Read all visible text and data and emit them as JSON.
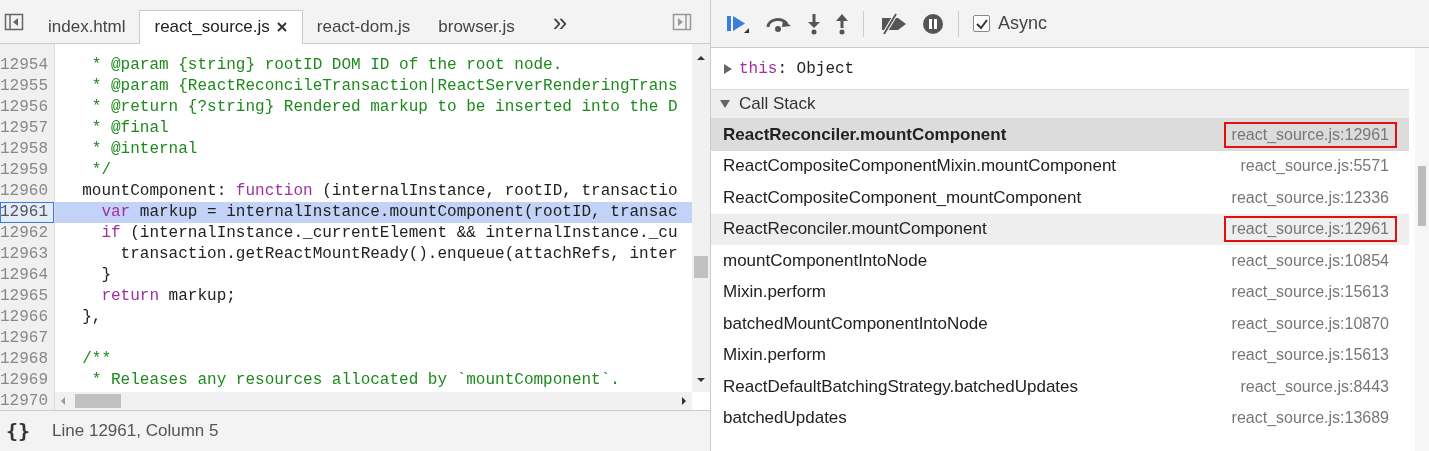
{
  "editor": {
    "tabs": [
      {
        "label": "index.html",
        "selected": false,
        "closable": false
      },
      {
        "label": "react_source.js",
        "selected": true,
        "closable": true
      },
      {
        "label": "react-dom.js",
        "selected": false,
        "closable": false
      },
      {
        "label": "browser.js",
        "selected": false,
        "closable": false
      }
    ],
    "more_tabs": "»",
    "lines": [
      {
        "number": "12954",
        "selected": false,
        "segments": [
          {
            "kind": "comment",
            "text": "   * @param {string} rootID DOM ID of the root node."
          }
        ]
      },
      {
        "number": "12955",
        "selected": false,
        "segments": [
          {
            "kind": "comment",
            "text": "   * @param {ReactReconcileTransaction|ReactServerRenderingTrans"
          }
        ]
      },
      {
        "number": "12956",
        "selected": false,
        "segments": [
          {
            "kind": "comment",
            "text": "   * @return {?string} Rendered markup to be inserted into the D"
          }
        ]
      },
      {
        "number": "12957",
        "selected": false,
        "segments": [
          {
            "kind": "comment",
            "text": "   * @final"
          }
        ]
      },
      {
        "number": "12958",
        "selected": false,
        "segments": [
          {
            "kind": "comment",
            "text": "   * @internal"
          }
        ]
      },
      {
        "number": "12959",
        "selected": false,
        "segments": [
          {
            "kind": "comment",
            "text": "   */"
          }
        ]
      },
      {
        "number": "12960",
        "selected": false,
        "segments": [
          {
            "kind": "plain",
            "text": "  mountComponent: "
          },
          {
            "kind": "keyword",
            "text": "function"
          },
          {
            "kind": "plain",
            "text": " (internalInstance, rootID, transactio"
          }
        ]
      },
      {
        "number": "12961",
        "selected": true,
        "segments": [
          {
            "kind": "keyword",
            "text": "    var"
          },
          {
            "kind": "plain",
            "text": " markup = internalInstance.mountComponent(rootID, transac"
          }
        ]
      },
      {
        "number": "12962",
        "selected": false,
        "segments": [
          {
            "kind": "keyword",
            "text": "    if"
          },
          {
            "kind": "plain",
            "text": " (internalInstance._currentElement && internalInstance._cu"
          }
        ]
      },
      {
        "number": "12963",
        "selected": false,
        "segments": [
          {
            "kind": "plain",
            "text": "      transaction.getReactMountReady().enqueue(attachRefs, inter"
          }
        ]
      },
      {
        "number": "12964",
        "selected": false,
        "segments": [
          {
            "kind": "plain",
            "text": "    }"
          }
        ]
      },
      {
        "number": "12965",
        "selected": false,
        "segments": [
          {
            "kind": "keyword",
            "text": "    return"
          },
          {
            "kind": "plain",
            "text": " markup;"
          }
        ]
      },
      {
        "number": "12966",
        "selected": false,
        "segments": [
          {
            "kind": "plain",
            "text": "  },"
          }
        ]
      },
      {
        "number": "12967",
        "selected": false
      },
      {
        "number": "12968",
        "selected": false,
        "segments": [
          {
            "kind": "comment",
            "text": "  /**"
          }
        ]
      },
      {
        "number": "12969",
        "selected": false,
        "segments": [
          {
            "kind": "comment",
            "text": "   * Releases any resources allocated by `mountComponent`."
          }
        ]
      },
      {
        "number": "12970",
        "selected": false
      }
    ],
    "status_bar": {
      "format_icon": "{}",
      "position": "Line 12961, Column 5"
    }
  },
  "debugger": {
    "async": {
      "label": "Async",
      "checked": true
    },
    "scope": {
      "name": "this",
      "value": ": Object"
    },
    "call_stack": {
      "title": "Call Stack",
      "expanded": true,
      "frames": [
        {
          "name": "ReactReconciler.mountComponent",
          "location": "react_source.js:12961",
          "selected": true,
          "hovered": false,
          "outlined": true
        },
        {
          "name": "ReactCompositeComponentMixin.mountComponent",
          "location": "react_source.js:5571",
          "selected": false,
          "hovered": false,
          "outlined": false
        },
        {
          "name": "ReactCompositeComponent_mountComponent",
          "location": "react_source.js:12336",
          "selected": false,
          "hovered": false,
          "outlined": false
        },
        {
          "name": "ReactReconciler.mountComponent",
          "location": "react_source.js:12961",
          "selected": false,
          "hovered": true,
          "outlined": true
        },
        {
          "name": "mountComponentIntoNode",
          "location": "react_source.js:10854",
          "selected": false,
          "hovered": false,
          "outlined": false
        },
        {
          "name": "Mixin.perform",
          "location": "react_source.js:15613",
          "selected": false,
          "hovered": false,
          "outlined": false
        },
        {
          "name": "batchedMountComponentIntoNode",
          "location": "react_source.js:10870",
          "selected": false,
          "hovered": false,
          "outlined": false
        },
        {
          "name": "Mixin.perform",
          "location": "react_source.js:15613",
          "selected": false,
          "hovered": false,
          "outlined": false
        },
        {
          "name": "ReactDefaultBatchingStrategy.batchedUpdates",
          "location": "react_source.js:8443",
          "selected": false,
          "hovered": false,
          "outlined": false
        },
        {
          "name": "batchedUpdates",
          "location": "react_source.js:13689",
          "selected": false,
          "hovered": false,
          "outlined": false
        }
      ]
    }
  }
}
